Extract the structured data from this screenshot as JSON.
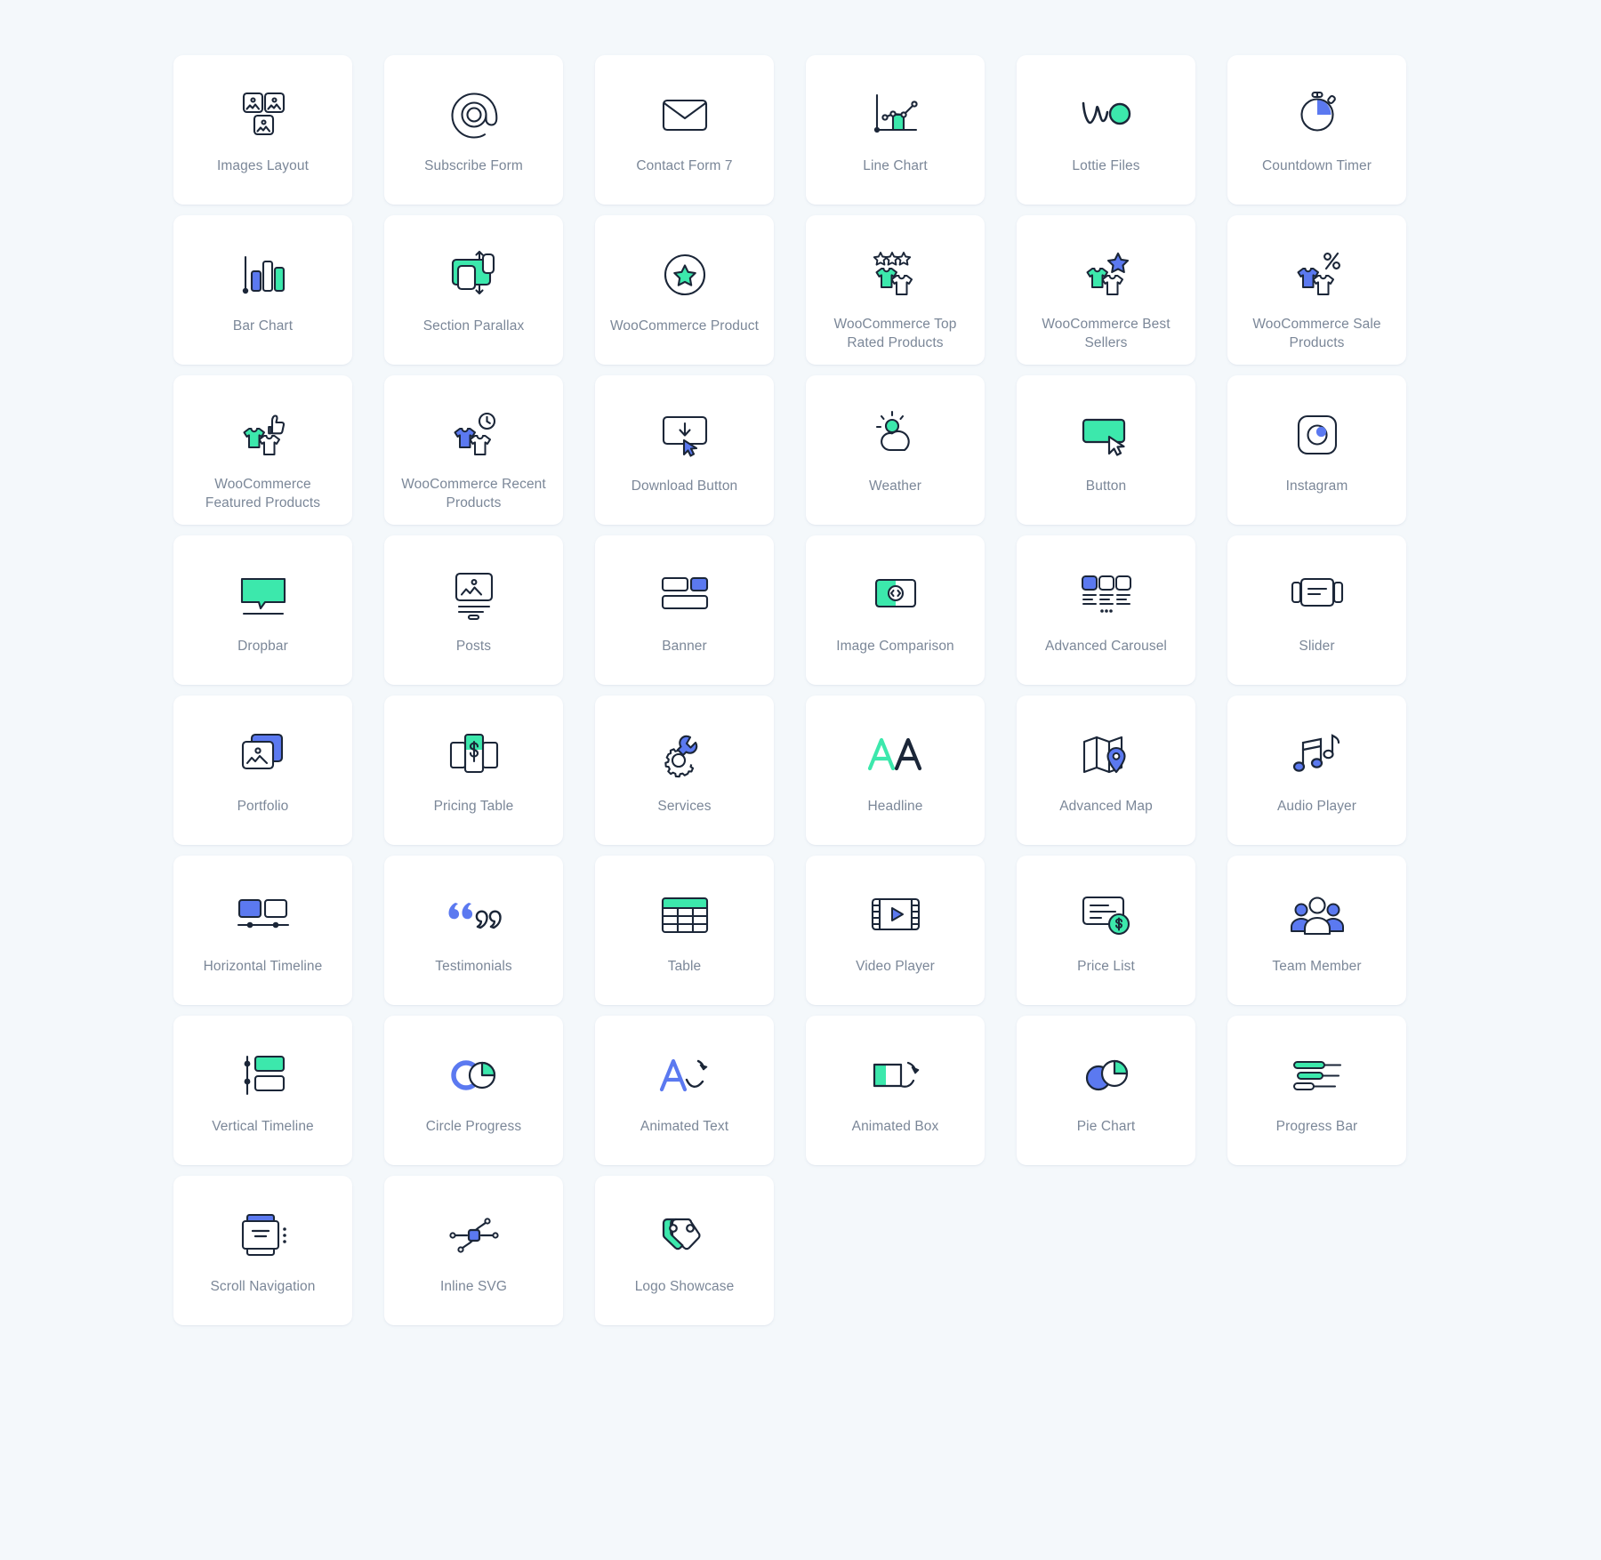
{
  "theme": {
    "background": "#f4f8fb",
    "card_background": "#ffffff",
    "stroke": "#1b2638",
    "green": "#3ce8ac",
    "blue": "#5b79f0",
    "label_color": "#7b8798"
  },
  "grid": {
    "columns": 6,
    "widgets": [
      {
        "label": "Images Layout",
        "icon": "images-layout-icon"
      },
      {
        "label": "Subscribe Form",
        "icon": "at-sign-icon"
      },
      {
        "label": "Contact Form 7",
        "icon": "envelope-icon"
      },
      {
        "label": "Line Chart",
        "icon": "line-chart-icon"
      },
      {
        "label": "Lottie Files",
        "icon": "lottie-icon"
      },
      {
        "label": "Countdown Timer",
        "icon": "stopwatch-icon"
      },
      {
        "label": "Bar Chart",
        "icon": "bar-chart-icon"
      },
      {
        "label": "Section Parallax",
        "icon": "section-parallax-icon"
      },
      {
        "label": "WooCommerce Product",
        "icon": "star-circle-icon"
      },
      {
        "label": "WooCommerce Top Rated Products",
        "icon": "shirts-stars-icon"
      },
      {
        "label": "WooCommerce Best Sellers",
        "icon": "shirts-star-icon"
      },
      {
        "label": "WooCommerce Sale Products",
        "icon": "shirts-percent-icon"
      },
      {
        "label": "WooCommerce Featured Products",
        "icon": "shirts-thumbsup-icon"
      },
      {
        "label": "WooCommerce Recent Products",
        "icon": "shirts-clock-icon"
      },
      {
        "label": "Download Button",
        "icon": "download-button-icon"
      },
      {
        "label": "Weather",
        "icon": "weather-icon"
      },
      {
        "label": "Button",
        "icon": "button-cursor-icon"
      },
      {
        "label": "Instagram",
        "icon": "instagram-icon"
      },
      {
        "label": "Dropbar",
        "icon": "dropbar-icon"
      },
      {
        "label": "Posts",
        "icon": "posts-icon"
      },
      {
        "label": "Banner",
        "icon": "banner-icon"
      },
      {
        "label": "Image Comparison",
        "icon": "image-comparison-icon"
      },
      {
        "label": "Advanced Carousel",
        "icon": "advanced-carousel-icon"
      },
      {
        "label": "Slider",
        "icon": "slider-icon"
      },
      {
        "label": "Portfolio",
        "icon": "portfolio-icon"
      },
      {
        "label": "Pricing Table",
        "icon": "pricing-table-icon"
      },
      {
        "label": "Services",
        "icon": "gear-wrench-icon"
      },
      {
        "label": "Headline",
        "icon": "headline-aa-icon"
      },
      {
        "label": "Advanced Map",
        "icon": "map-pin-icon"
      },
      {
        "label": "Audio Player",
        "icon": "music-notes-icon"
      },
      {
        "label": "Horizontal Timeline",
        "icon": "horizontal-timeline-icon"
      },
      {
        "label": "Testimonials",
        "icon": "quote-marks-icon"
      },
      {
        "label": "Table",
        "icon": "table-icon"
      },
      {
        "label": "Video Player",
        "icon": "film-play-icon"
      },
      {
        "label": "Price List",
        "icon": "price-list-icon"
      },
      {
        "label": "Team Member",
        "icon": "team-member-icon"
      },
      {
        "label": "Vertical Timeline",
        "icon": "vertical-timeline-icon"
      },
      {
        "label": "Circle Progress",
        "icon": "circle-progress-icon"
      },
      {
        "label": "Animated Text",
        "icon": "animated-text-icon"
      },
      {
        "label": "Animated Box",
        "icon": "animated-box-icon"
      },
      {
        "label": "Pie Chart",
        "icon": "pie-chart-icon"
      },
      {
        "label": "Progress Bar",
        "icon": "progress-bar-icon"
      },
      {
        "label": "Scroll Navigation",
        "icon": "scroll-navigation-icon"
      },
      {
        "label": "Inline SVG",
        "icon": "inline-svg-icon"
      },
      {
        "label": "Logo Showcase",
        "icon": "logo-tags-icon"
      }
    ]
  }
}
